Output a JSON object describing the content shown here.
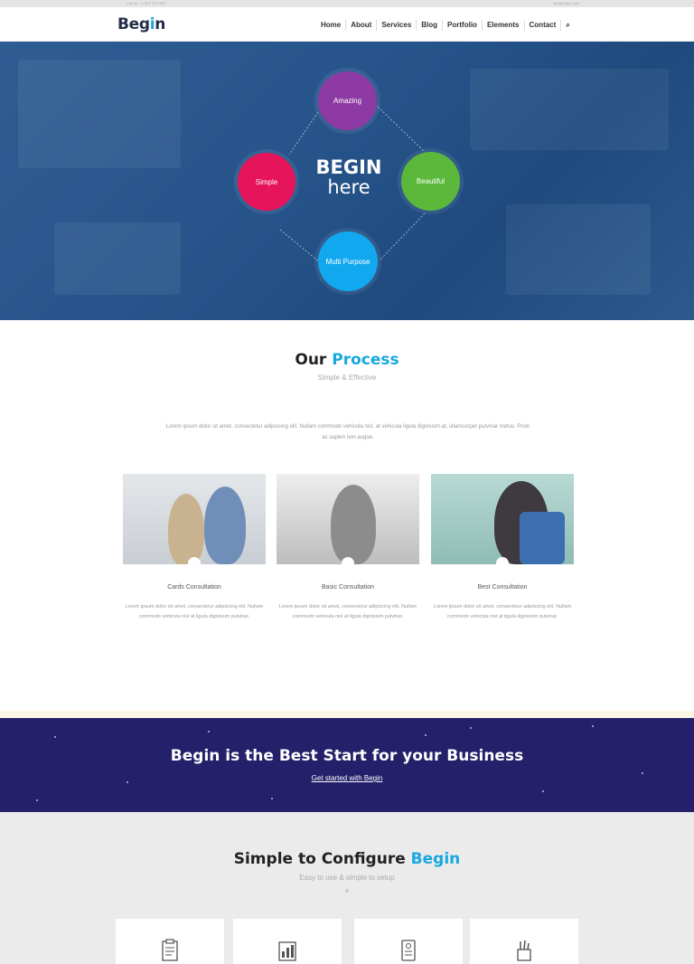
{
  "topbar": {
    "left_text": "Call us: +1 800 123 4567",
    "right_text": "info@begin.com"
  },
  "header": {
    "logo": {
      "text_main": "Beg",
      "text_accent": "i",
      "text_end": "n"
    },
    "nav": [
      "Home",
      "About",
      "Services",
      "Blog",
      "Portfolio",
      "Elements",
      "Contact",
      "⌕"
    ]
  },
  "hero": {
    "title_line1": "BEGIN",
    "title_line2": "here",
    "circles": {
      "purple": "Amazing",
      "pink": "Simple",
      "green": "Beautiful",
      "blue": "Multi Purpose"
    }
  },
  "process": {
    "title_main": "Our ",
    "title_accent": "Process",
    "subtitle": "Simple & Effective",
    "text": "Lorem ipsum dolor sit amet, consectetur adipiscing elit. Nullam commodo vehicula nisl, at vehicula ligula dignissim at, ullamcorper pulvinar metus. Proin ac sapien non augue.",
    "cards": [
      {
        "title": "Cards Consultation",
        "text": "Lorem ipsum dolor sit amet, consectetur adipiscing elit. Nullam commodo vehicula nisl at ligula dignissim pulvinar."
      },
      {
        "title": "Basic Consultation",
        "text": "Lorem ipsum dolor sit amet, consectetur adipiscing elit. Nullam commodo vehicula nisl at ligula dignissim pulvinar."
      },
      {
        "title": "Best Consultation",
        "text": "Lorem ipsum dolor sit amet, consectetur adipiscing elit. Nullam commodo vehicula nisl at ligula dignissim pulvinar."
      }
    ]
  },
  "banner": {
    "title": "Begin is the Best Start for your Business",
    "link": "Get started with Begin"
  },
  "config": {
    "title_main": "Simple to Configure ",
    "title_accent": "Begin",
    "subtitle": "Easy to use & simple to setup",
    "features": [
      "clipboard-icon",
      "chart-icon",
      "document-icon",
      "pencils-icon"
    ]
  },
  "colors": {
    "accent": "#18a8e0",
    "hero_bg": "#27558b",
    "purple": "#8e3aa4",
    "pink": "#e6145a",
    "green": "#5cb83a",
    "blue": "#12a8ef",
    "banner_bg": "#24206a"
  }
}
